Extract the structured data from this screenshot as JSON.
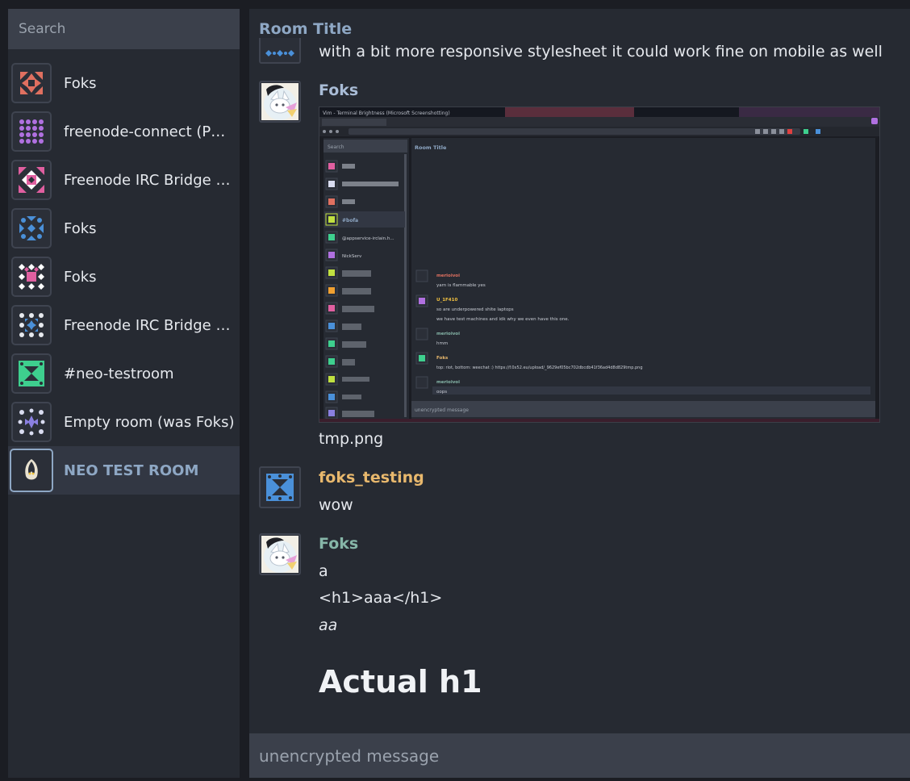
{
  "sidebar": {
    "search_placeholder": "Search",
    "rooms": [
      {
        "name": "Foks"
      },
      {
        "name": "freenode-connect (PM o..."
      },
      {
        "name": "Freenode IRC Bridge sta..."
      },
      {
        "name": "Foks"
      },
      {
        "name": "Foks"
      },
      {
        "name": "Freenode IRC Bridge sta..."
      },
      {
        "name": "#neo-testroom"
      },
      {
        "name": "Empty room (was Foks)"
      },
      {
        "name": "NEO TEST ROOM"
      }
    ]
  },
  "main": {
    "room_title": "Room Title",
    "messages": [
      {
        "text": "with a bit more responsive stylesheet it could work fine on mobile as well"
      },
      {
        "sender": "Foks",
        "sender_color": "#a9bcd6",
        "attachment_caption": "tmp.png"
      },
      {
        "sender": "foks_testing",
        "sender_color": "#e8b86d",
        "text": "wow"
      },
      {
        "sender": "Foks",
        "sender_color": "#86b6a8",
        "lines": [
          "a",
          "<h1>aaa</h1>",
          "aa"
        ],
        "heading": "Actual h1"
      }
    ],
    "composer_placeholder": "unencrypted message"
  },
  "embedded_screenshot": {
    "window_title": "Vim - Terminal Brightness (Microsoft Screenshotting)",
    "search": "Search",
    "room_title": "Room Title",
    "rooms": [
      "#bofa",
      "@appservice-irclain.h...",
      "NickServ"
    ],
    "messages": [
      {
        "sender": "merioivoi",
        "lines": [
          "yarn is flammable yes"
        ]
      },
      {
        "sender": "U_1F410",
        "lines": [
          "so are underpowered shite laptops",
          "we have test machines and idk why we even have this one."
        ]
      },
      {
        "sender": "merioivoi",
        "lines": [
          "hmm"
        ]
      },
      {
        "sender": "Foks",
        "lines": [
          "top: riot, bottom: weechat :) https://f.0x52.eu/upload/_9629ef05bc702dbcdb41f36ad4d8d829tmp.png"
        ]
      },
      {
        "sender": "merioivoi",
        "lines": [
          "oops"
        ]
      }
    ],
    "composer": "unencrypted message"
  }
}
